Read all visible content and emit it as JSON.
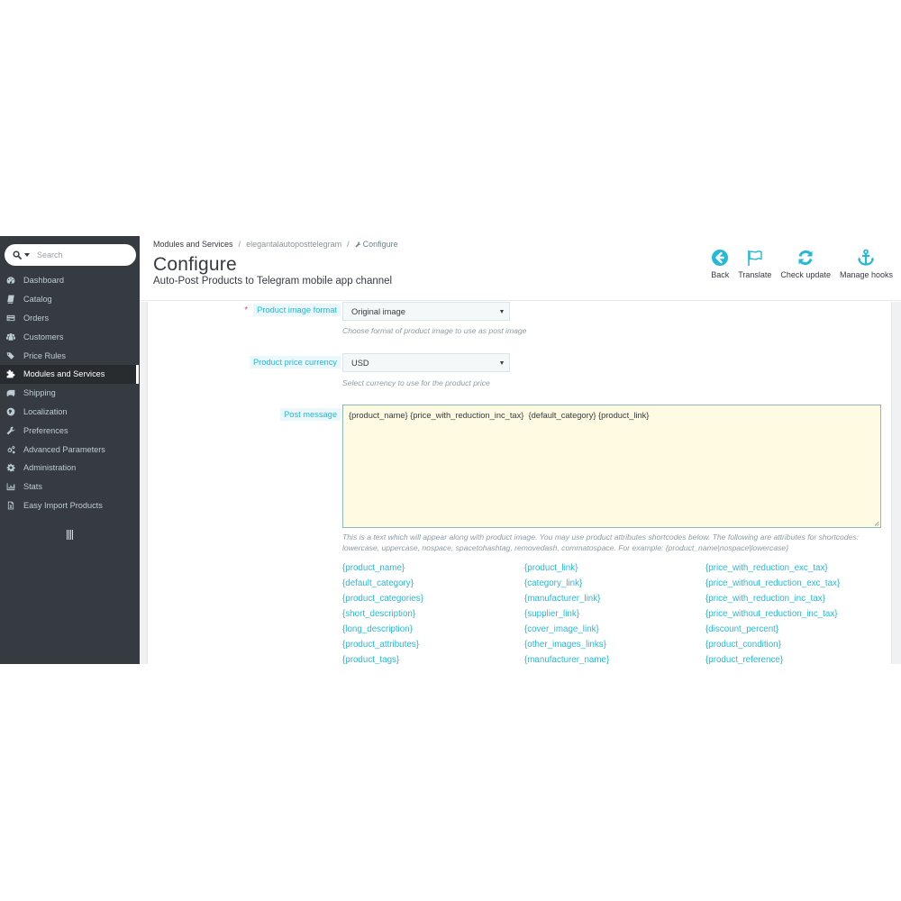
{
  "sidebar": {
    "search": {
      "placeholder": "Search",
      "toggle_icon": "search-icon"
    },
    "items": [
      {
        "label": "Dashboard",
        "icon": "dashboard-icon",
        "active": false
      },
      {
        "label": "Catalog",
        "icon": "book-icon",
        "active": false
      },
      {
        "label": "Orders",
        "icon": "credit-card-icon",
        "active": false
      },
      {
        "label": "Customers",
        "icon": "users-icon",
        "active": false
      },
      {
        "label": "Price Rules",
        "icon": "tags-icon",
        "active": false
      },
      {
        "label": "Modules and Services",
        "icon": "puzzle-icon",
        "active": true
      },
      {
        "label": "Shipping",
        "icon": "truck-icon",
        "active": false
      },
      {
        "label": "Localization",
        "icon": "globe-icon",
        "active": false
      },
      {
        "label": "Preferences",
        "icon": "wrench-icon",
        "active": false
      },
      {
        "label": "Advanced Parameters",
        "icon": "cogs-icon",
        "active": false
      },
      {
        "label": "Administration",
        "icon": "gear-icon",
        "active": false
      },
      {
        "label": "Stats",
        "icon": "bar-chart-icon",
        "active": false
      },
      {
        "label": "Easy Import Products",
        "icon": "excel-file-icon",
        "active": false
      }
    ],
    "collapse_icon": "collapse-bars-icon"
  },
  "header": {
    "breadcrumb": [
      "Modules and Services",
      "elegantalautoposttelegram",
      "Configure"
    ],
    "title": "Configure",
    "subtitle": "Auto-Post Products to Telegram mobile app channel",
    "toolbar": [
      {
        "label": "Back",
        "icon": "arrow-left-circle-icon"
      },
      {
        "label": "Translate",
        "icon": "flag-icon"
      },
      {
        "label": "Check update",
        "icon": "refresh-icon"
      },
      {
        "label": "Manage hooks",
        "icon": "anchor-icon"
      }
    ]
  },
  "form": {
    "image_format": {
      "label": "Product image format",
      "required": true,
      "value": "Original image",
      "help": "Choose format of product image to use as post image"
    },
    "currency": {
      "label": "Product price currency",
      "value": "USD",
      "help": "Select currency to use for the product price"
    },
    "post_message": {
      "label": "Post message",
      "value": "{product_name} {price_with_reduction_inc_tax}  {default_category} {product_link}",
      "help": "This is a text which will appear along with product image. You may use product attributes shortcodes below. The following are attributes for shortcodes: lowercase, uppercase, nospace, spacetohashtag, removedash, commatospace. For example: {product_name|nospace|lowercase}"
    },
    "shortcodes": [
      "{product_name}",
      "{product_link}",
      "{price_with_reduction_exc_tax}",
      "{default_category}",
      "{category_link}",
      "{price_without_reduction_exc_tax}",
      "{product_categories}",
      "{manufacturer_link}",
      "{price_with_reduction_inc_tax}",
      "{short_description}",
      "{supplier_link}",
      "{price_without_reduction_inc_tax}",
      "{long_description}",
      "{cover_image_link}",
      "{discount_percent}",
      "{product_attributes}",
      "{other_images_links}",
      "{product_condition}",
      "{product_tags}",
      "{manufacturer_name}",
      "{product_reference}"
    ]
  },
  "colors": {
    "accent": "#25b9d7",
    "sidebar_bg": "#363a41",
    "textarea_bg": "#fffbe2",
    "required": "#c05c67"
  }
}
